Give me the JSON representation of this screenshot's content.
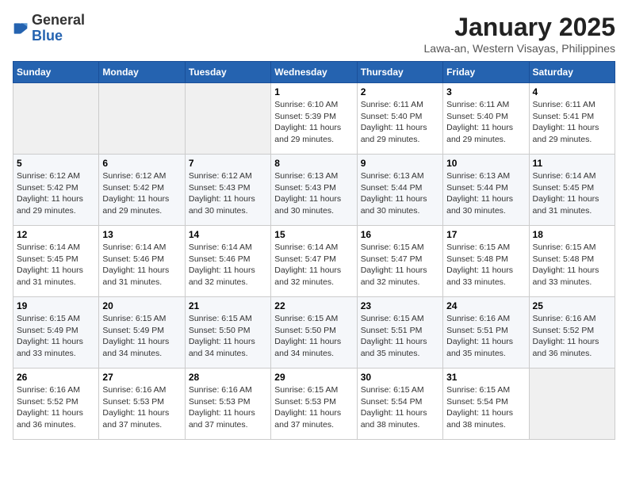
{
  "logo": {
    "general": "General",
    "blue": "Blue"
  },
  "title": "January 2025",
  "subtitle": "Lawa-an, Western Visayas, Philippines",
  "weekdays": [
    "Sunday",
    "Monday",
    "Tuesday",
    "Wednesday",
    "Thursday",
    "Friday",
    "Saturday"
  ],
  "weeks": [
    [
      {
        "day": null
      },
      {
        "day": null
      },
      {
        "day": null
      },
      {
        "day": "1",
        "sunrise": "6:10 AM",
        "sunset": "5:39 PM",
        "daylight": "11 hours and 29 minutes."
      },
      {
        "day": "2",
        "sunrise": "6:11 AM",
        "sunset": "5:40 PM",
        "daylight": "11 hours and 29 minutes."
      },
      {
        "day": "3",
        "sunrise": "6:11 AM",
        "sunset": "5:40 PM",
        "daylight": "11 hours and 29 minutes."
      },
      {
        "day": "4",
        "sunrise": "6:11 AM",
        "sunset": "5:41 PM",
        "daylight": "11 hours and 29 minutes."
      }
    ],
    [
      {
        "day": "5",
        "sunrise": "6:12 AM",
        "sunset": "5:42 PM",
        "daylight": "11 hours and 29 minutes."
      },
      {
        "day": "6",
        "sunrise": "6:12 AM",
        "sunset": "5:42 PM",
        "daylight": "11 hours and 29 minutes."
      },
      {
        "day": "7",
        "sunrise": "6:12 AM",
        "sunset": "5:43 PM",
        "daylight": "11 hours and 30 minutes."
      },
      {
        "day": "8",
        "sunrise": "6:13 AM",
        "sunset": "5:43 PM",
        "daylight": "11 hours and 30 minutes."
      },
      {
        "day": "9",
        "sunrise": "6:13 AM",
        "sunset": "5:44 PM",
        "daylight": "11 hours and 30 minutes."
      },
      {
        "day": "10",
        "sunrise": "6:13 AM",
        "sunset": "5:44 PM",
        "daylight": "11 hours and 30 minutes."
      },
      {
        "day": "11",
        "sunrise": "6:14 AM",
        "sunset": "5:45 PM",
        "daylight": "11 hours and 31 minutes."
      }
    ],
    [
      {
        "day": "12",
        "sunrise": "6:14 AM",
        "sunset": "5:45 PM",
        "daylight": "11 hours and 31 minutes."
      },
      {
        "day": "13",
        "sunrise": "6:14 AM",
        "sunset": "5:46 PM",
        "daylight": "11 hours and 31 minutes."
      },
      {
        "day": "14",
        "sunrise": "6:14 AM",
        "sunset": "5:46 PM",
        "daylight": "11 hours and 32 minutes."
      },
      {
        "day": "15",
        "sunrise": "6:14 AM",
        "sunset": "5:47 PM",
        "daylight": "11 hours and 32 minutes."
      },
      {
        "day": "16",
        "sunrise": "6:15 AM",
        "sunset": "5:47 PM",
        "daylight": "11 hours and 32 minutes."
      },
      {
        "day": "17",
        "sunrise": "6:15 AM",
        "sunset": "5:48 PM",
        "daylight": "11 hours and 33 minutes."
      },
      {
        "day": "18",
        "sunrise": "6:15 AM",
        "sunset": "5:48 PM",
        "daylight": "11 hours and 33 minutes."
      }
    ],
    [
      {
        "day": "19",
        "sunrise": "6:15 AM",
        "sunset": "5:49 PM",
        "daylight": "11 hours and 33 minutes."
      },
      {
        "day": "20",
        "sunrise": "6:15 AM",
        "sunset": "5:49 PM",
        "daylight": "11 hours and 34 minutes."
      },
      {
        "day": "21",
        "sunrise": "6:15 AM",
        "sunset": "5:50 PM",
        "daylight": "11 hours and 34 minutes."
      },
      {
        "day": "22",
        "sunrise": "6:15 AM",
        "sunset": "5:50 PM",
        "daylight": "11 hours and 34 minutes."
      },
      {
        "day": "23",
        "sunrise": "6:15 AM",
        "sunset": "5:51 PM",
        "daylight": "11 hours and 35 minutes."
      },
      {
        "day": "24",
        "sunrise": "6:16 AM",
        "sunset": "5:51 PM",
        "daylight": "11 hours and 35 minutes."
      },
      {
        "day": "25",
        "sunrise": "6:16 AM",
        "sunset": "5:52 PM",
        "daylight": "11 hours and 36 minutes."
      }
    ],
    [
      {
        "day": "26",
        "sunrise": "6:16 AM",
        "sunset": "5:52 PM",
        "daylight": "11 hours and 36 minutes."
      },
      {
        "day": "27",
        "sunrise": "6:16 AM",
        "sunset": "5:53 PM",
        "daylight": "11 hours and 37 minutes."
      },
      {
        "day": "28",
        "sunrise": "6:16 AM",
        "sunset": "5:53 PM",
        "daylight": "11 hours and 37 minutes."
      },
      {
        "day": "29",
        "sunrise": "6:15 AM",
        "sunset": "5:53 PM",
        "daylight": "11 hours and 37 minutes."
      },
      {
        "day": "30",
        "sunrise": "6:15 AM",
        "sunset": "5:54 PM",
        "daylight": "11 hours and 38 minutes."
      },
      {
        "day": "31",
        "sunrise": "6:15 AM",
        "sunset": "5:54 PM",
        "daylight": "11 hours and 38 minutes."
      },
      {
        "day": null
      }
    ]
  ]
}
